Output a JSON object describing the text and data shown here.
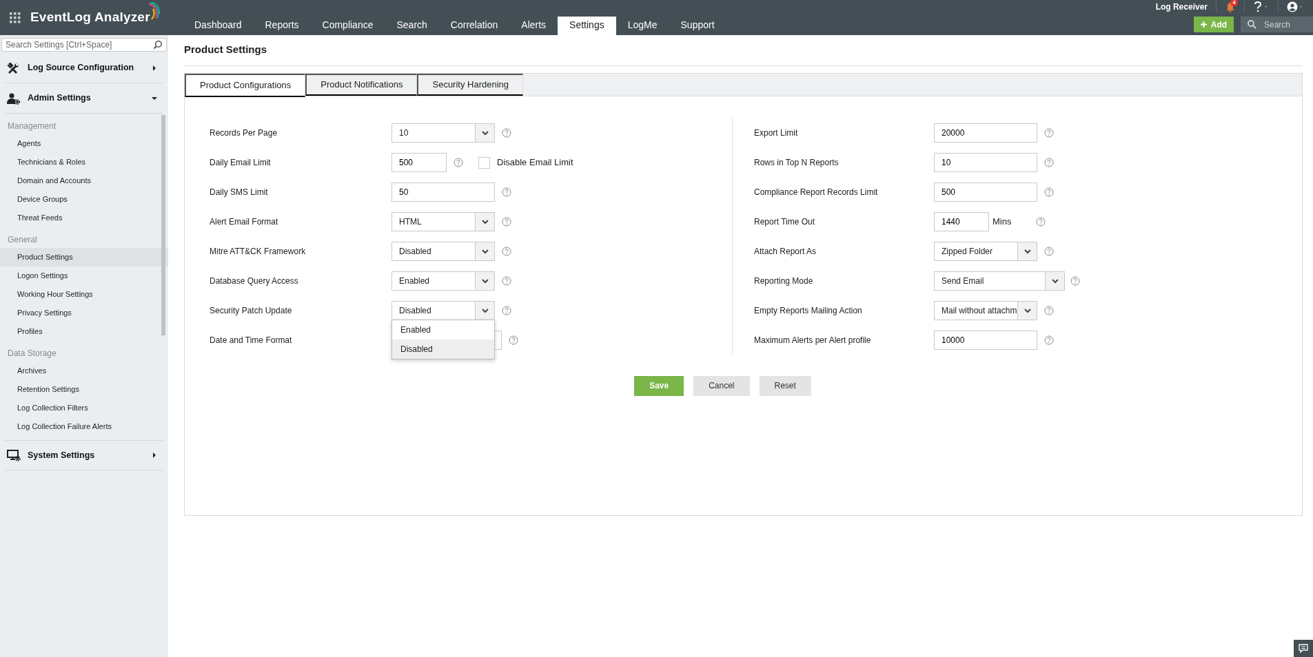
{
  "topbar": {
    "app_name": "EventLog Analyzer",
    "nav": [
      {
        "label": "Dashboard",
        "selected": false
      },
      {
        "label": "Reports",
        "selected": false
      },
      {
        "label": "Compliance",
        "selected": false
      },
      {
        "label": "Search",
        "selected": false
      },
      {
        "label": "Correlation",
        "selected": false
      },
      {
        "label": "Alerts",
        "selected": false
      },
      {
        "label": "Settings",
        "selected": true
      },
      {
        "label": "LogMe",
        "selected": false
      },
      {
        "label": "Support",
        "selected": false
      }
    ],
    "log_receiver": "Log Receiver",
    "notification_count": "4",
    "add_button": "Add",
    "search": {
      "placeholder": "Search"
    }
  },
  "sidebar": {
    "search": {
      "placeholder": "Search Settings [Ctrl+Space]"
    },
    "sections": [
      {
        "kind": "tools",
        "label": "Log Source Configuration",
        "expanded": false
      },
      {
        "kind": "admin",
        "label": "Admin Settings",
        "expanded": true,
        "groups": [
          {
            "heading": "Management",
            "items": [
              {
                "label": "Agents",
                "selected": false
              },
              {
                "label": "Technicians & Roles",
                "selected": false
              },
              {
                "label": "Domain and Accounts",
                "selected": false
              },
              {
                "label": "Device Groups",
                "selected": false
              },
              {
                "label": "Threat Feeds",
                "selected": false
              }
            ]
          },
          {
            "heading": "General",
            "items": [
              {
                "label": "Product Settings",
                "selected": true
              },
              {
                "label": "Logon Settings",
                "selected": false
              },
              {
                "label": "Working Hour Settings",
                "selected": false
              },
              {
                "label": "Privacy Settings",
                "selected": false
              },
              {
                "label": "Profiles",
                "selected": false
              }
            ]
          },
          {
            "heading": "Data Storage",
            "items": [
              {
                "label": "Archives",
                "selected": false
              },
              {
                "label": "Retention Settings",
                "selected": false
              },
              {
                "label": "Log Collection Filters",
                "selected": false
              },
              {
                "label": "Log Collection Failure Alerts",
                "selected": false
              }
            ]
          }
        ]
      },
      {
        "kind": "system",
        "label": "System Settings",
        "expanded": false
      }
    ]
  },
  "page_title": "Product Settings",
  "tabs": [
    {
      "label": "Product Configurations",
      "selected": true
    },
    {
      "label": "Product Notifications",
      "selected": false
    },
    {
      "label": "Security Hardening",
      "selected": false
    }
  ],
  "left_fields": [
    {
      "label": "Records Per Page",
      "kind": "select",
      "value": "10"
    },
    {
      "label": "Daily Email Limit",
      "kind": "short-text",
      "value": "500",
      "checkbox": {
        "label": "Disable Email Limit",
        "checked": false
      }
    },
    {
      "label": "Daily SMS Limit",
      "kind": "text",
      "value": "50"
    },
    {
      "label": "Alert Email Format",
      "kind": "select",
      "value": "HTML"
    },
    {
      "label": "Mitre ATT&CK Framework",
      "kind": "select",
      "value": "Disabled"
    },
    {
      "label": "Database Query Access",
      "kind": "select",
      "value": "Enabled"
    },
    {
      "label": "Security Patch Update",
      "kind": "select",
      "value": "Disabled",
      "expanded": true,
      "options": [
        {
          "label": "Enabled",
          "selected": false
        },
        {
          "label": "Disabled",
          "selected": true
        }
      ]
    },
    {
      "label": "Date and Time Format",
      "kind": "covered"
    }
  ],
  "right_fields": [
    {
      "label": "Export Limit",
      "kind": "text",
      "value": "20000"
    },
    {
      "label": "Rows in Top N Reports",
      "kind": "text",
      "value": "10"
    },
    {
      "label": "Compliance Report Records Limit",
      "kind": "text",
      "value": "500"
    },
    {
      "label": "Report Time Out",
      "kind": "short-text",
      "value": "1440",
      "unit": "Mins"
    },
    {
      "label": "Attach Report As",
      "kind": "select",
      "value": "Zipped Folder"
    },
    {
      "label": "Reporting Mode",
      "kind": "wide-select",
      "value": "Send Email"
    },
    {
      "label": "Empty Reports Mailing Action",
      "kind": "select",
      "value": "Mail without attachm"
    },
    {
      "label": "Maximum Alerts per Alert profile",
      "kind": "text",
      "value": "10000"
    }
  ],
  "buttons": [
    {
      "kind": "primary",
      "label": "Save"
    },
    {
      "kind": "secondary",
      "label": "Cancel"
    },
    {
      "kind": "secondary",
      "label": "Reset"
    }
  ]
}
